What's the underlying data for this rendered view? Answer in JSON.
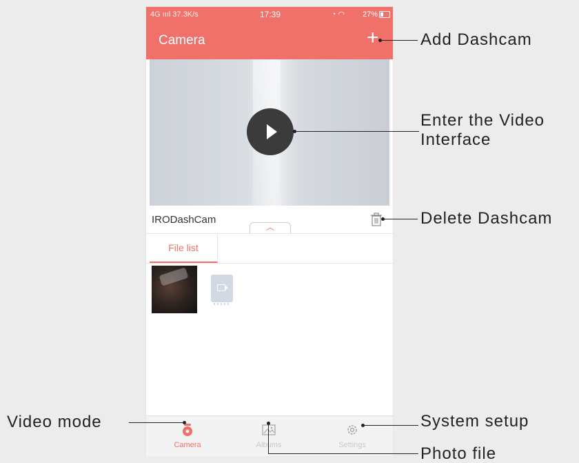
{
  "status_bar": {
    "signal": "4G ıııl 37.3K/s",
    "time": "17:39",
    "battery": "27%"
  },
  "app_bar": {
    "title": "Camera",
    "add_icon": "plus-icon"
  },
  "video": {
    "play_icon": "play-icon"
  },
  "device": {
    "name": "IRODashCam",
    "collapse_icon": "chevron-up-icon",
    "delete_icon": "trash-icon"
  },
  "tabs": {
    "file_list": "File list"
  },
  "files": [
    {
      "type": "video-thumbnail"
    },
    {
      "type": "video-file-icon"
    }
  ],
  "bottom_nav": {
    "items": [
      {
        "label": "Camera",
        "icon": "camera-icon",
        "active": true
      },
      {
        "label": "Albums",
        "icon": "albums-icon",
        "active": false
      },
      {
        "label": "Settings",
        "icon": "settings-icon",
        "active": false
      }
    ]
  },
  "callouts": {
    "add_dashcam": "Add Dashcam",
    "enter_video_line1": "Enter the Video",
    "enter_video_line2": "Interface",
    "delete_dashcam": "Delete Dashcam",
    "video_mode": "Video mode",
    "system_setup": "System setup",
    "photo_file": "Photo file"
  },
  "colors": {
    "accent": "#f0706a",
    "background": "#ececec",
    "inactive": "#c8c8c8"
  }
}
